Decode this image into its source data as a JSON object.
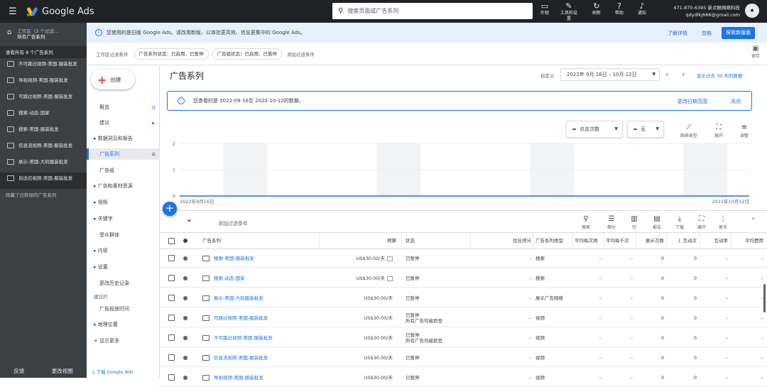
{
  "header": {
    "product": "Google Ads",
    "search_placeholder": "搜索页面或广告系列",
    "icons": [
      {
        "name": "appearance-icon",
        "glyph": "▭",
        "label": "外观"
      },
      {
        "name": "tools-icon",
        "glyph": "✎",
        "label": "工具和设置"
      },
      {
        "name": "refresh-icon",
        "glyph": "↻",
        "label": "刷新"
      },
      {
        "name": "help-icon",
        "glyph": "?",
        "label": "帮助"
      },
      {
        "name": "notification-icon",
        "glyph": "♪",
        "label": "通知"
      }
    ],
    "account_line1": "471-870-6395 新点联网络科技",
    "account_line2": "qdydlkj666@gmail.com"
  },
  "left_nav": {
    "workspace_line1": "工作区（2 个过滤...",
    "workspace_line2": "所有广告系列",
    "heading": "查看所有 8 个广告系列",
    "items": [
      "不可跳过视频-美国-服装批发",
      "导视视频-美国-服装批发",
      "可跳过视频-美国-服装批发",
      "搜索-动态-国家",
      "搜索-美国-服装批发",
      "信息流视频-美国-服装批发",
      "展示-美国-大码服装批发",
      "自适应视频-美国-服装批发"
    ],
    "removed_label": "隐藏了已移除的广告系列",
    "footer_feedback": "反馈",
    "footer_change_view": "更改视图"
  },
  "banner": {
    "message": "您使用的是旧版 Google Ads。请改用新版，以体验更高效、信息更集中的 Google Ads。",
    "learn_more": "了解详情",
    "dismiss": "忽略",
    "explore": "探索新版面"
  },
  "filters": {
    "label": "工作区过滤条件",
    "chips": [
      "广告系列状态：已启用、已暂停",
      "广告组状态：已启用、已暂停"
    ],
    "add_filter": "添加过滤条件",
    "save": "保存"
  },
  "page_nav": {
    "create": "创建",
    "items": {
      "overview": "概览",
      "recommendations": "建议",
      "insights": "数据洞见和报告",
      "campaigns": "广告系列",
      "adgroups": "广告组",
      "ads": "广告和素材资源",
      "videos": "视频",
      "keywords": "关键字",
      "audiences": "受众群体",
      "content": "内容",
      "settings": "设置",
      "history": "更改历史记录",
      "suggest": "建议的",
      "schedule": "广告投放时间",
      "locations": "地理位置",
      "more": "显示更多",
      "download": "下载 Google Ads"
    }
  },
  "main": {
    "title": "广告系列",
    "custom_label": "自定义",
    "date_range": "2022年 9月 16日 – 10月 12日",
    "compare_link": "显示过去 30 天的数据",
    "info_message": "您查看的是 2022-09-16至 2022-10-12的数据。",
    "change_range": "更改日期范围",
    "close": "关闭",
    "metric1": "点击次数",
    "metric1_color": "#1a73e8",
    "metric2": "无",
    "metric2_color": "#d93025",
    "chart_tools": [
      {
        "name": "chart-type-icon",
        "glyph": "⟋",
        "label": "图表类型"
      },
      {
        "name": "expand-icon",
        "glyph": "⛶",
        "label": "展开"
      },
      {
        "name": "adjust-icon",
        "glyph": "≡",
        "label": "调整"
      }
    ]
  },
  "chart_data": {
    "type": "line",
    "x_start": "2022年9月16日",
    "x_end": "2022年10月12日",
    "yticks": [
      0,
      1,
      2
    ],
    "ylim": [
      0,
      2
    ],
    "series": [
      {
        "name": "点击次数",
        "values": [
          0,
          0,
          0,
          0,
          0,
          0,
          0,
          0,
          0,
          0,
          0,
          0,
          0,
          0,
          0,
          0,
          0,
          0,
          0,
          0,
          0,
          0,
          0,
          0,
          0,
          0,
          0
        ]
      }
    ],
    "weekend_bands": 4
  },
  "table_toolbar": {
    "add_filter": "添加过滤条件",
    "tools": [
      {
        "name": "search-icon",
        "glyph": "⚲",
        "label": "搜索"
      },
      {
        "name": "segment-icon",
        "glyph": "☰",
        "label": "细分"
      },
      {
        "name": "columns-icon",
        "glyph": "▥",
        "label": "列"
      },
      {
        "name": "reports-icon",
        "glyph": "▤",
        "label": "报告"
      },
      {
        "name": "download-icon",
        "glyph": "⤓",
        "label": "下载"
      },
      {
        "name": "expand-icon",
        "glyph": "⛶",
        "label": "展开"
      },
      {
        "name": "more-icon",
        "glyph": "⋮",
        "label": "更多"
      }
    ]
  },
  "table": {
    "headers": {
      "campaign": "广告系列",
      "budget": "预算",
      "status": "状态",
      "optimization": "优化得分",
      "type": "广告系列类型",
      "avg_cpv": "平均每次观",
      "avg_cpm": "平均每千次",
      "impressions": "展示次数",
      "interactions": "↓ 互动次",
      "interaction_rate": "互动率",
      "avg_cost": "平均费用"
    },
    "rows": [
      {
        "name": "搜索-美国-服装批发",
        "budget": "US$30.00/天",
        "status": "已暂停",
        "status2": "",
        "opt": "–",
        "type": "搜索",
        "cpv": "–",
        "cpm": "–",
        "imp": "0",
        "int": "0",
        "rate": "–",
        "cost": "–"
      },
      {
        "name": "搜索-动态-国家",
        "budget": "US$30.00/天",
        "status": "已暂停",
        "status2": "",
        "opt": "–",
        "type": "搜索",
        "cpv": "–",
        "cpm": "–",
        "imp": "0",
        "int": "0",
        "rate": "–",
        "cost": "–"
      },
      {
        "name": "展示-美国-大码服装批发",
        "budget": "US$30.00/天",
        "status": "已暂停",
        "status2": "",
        "opt": "–",
        "type": "展示广告网络",
        "cpv": "–",
        "cpm": "–",
        "imp": "0",
        "int": "0",
        "rate": "–",
        "cost": "–"
      },
      {
        "name": "可跳过视频-美国-服装批发",
        "budget": "US$30.00/天",
        "status": "已暂停",
        "status2": "所有广告均被拒登",
        "opt": "–",
        "type": "视频",
        "cpv": "–",
        "cpm": "–",
        "imp": "0",
        "int": "0",
        "rate": "–",
        "cost": "–"
      },
      {
        "name": "不可跳过视频-美国-服装批发",
        "budget": "US$30.00/天",
        "status": "已暂停",
        "status2": "所有广告均被拒登",
        "opt": "–",
        "type": "视频",
        "cpv": "–",
        "cpm": "–",
        "imp": "0",
        "int": "0",
        "rate": "–",
        "cost": "–"
      },
      {
        "name": "信息流视频-美国-服装批发",
        "budget": "US$30.00/天",
        "status": "已暂停",
        "status2": "",
        "opt": "–",
        "type": "视频",
        "cpv": "–",
        "cpm": "–",
        "imp": "0",
        "int": "0",
        "rate": "–",
        "cost": "–"
      },
      {
        "name": "导视视频-美国-服装批发",
        "budget": "US$30.00/天",
        "status": "已暂停",
        "status2": "",
        "opt": "–",
        "type": "视频",
        "cpv": "–",
        "cpm": "–",
        "imp": "0",
        "int": "0",
        "rate": "–",
        "cost": "–"
      }
    ]
  }
}
